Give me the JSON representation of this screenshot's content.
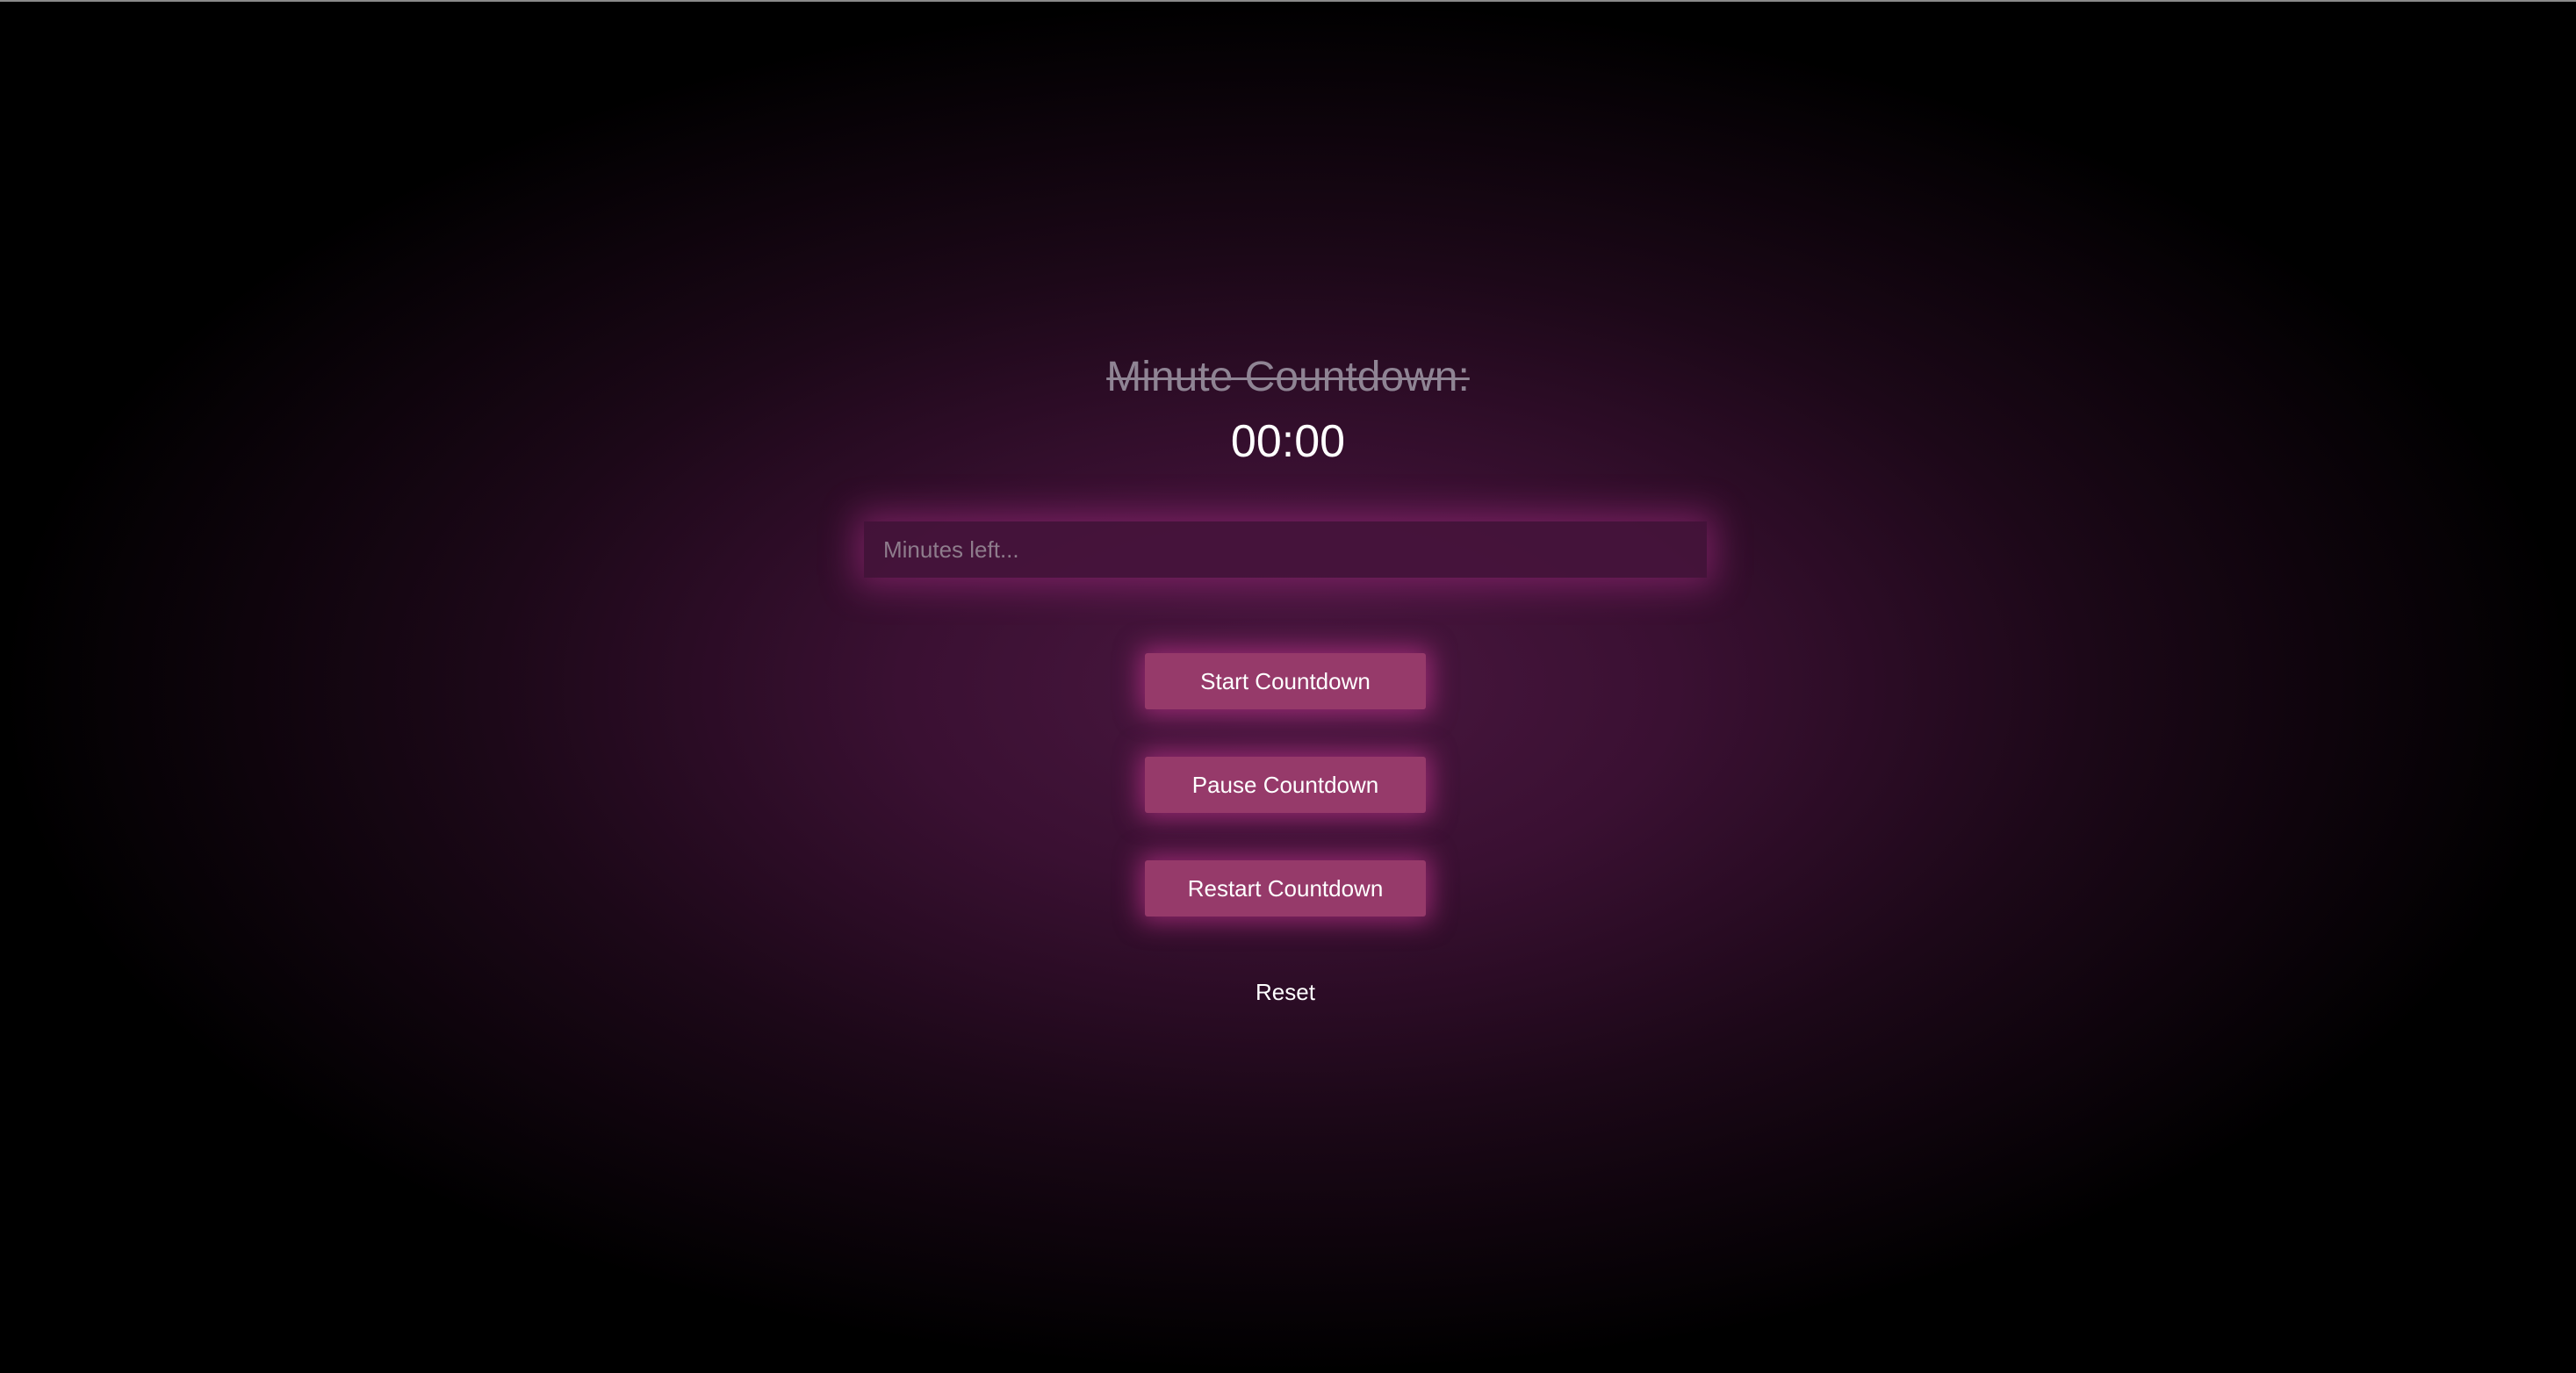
{
  "header": {
    "title": "Minute Countdown:",
    "timer_display": "00:00"
  },
  "input": {
    "placeholder": "Minutes left...",
    "value": ""
  },
  "buttons": {
    "start_label": "Start Countdown",
    "pause_label": "Pause Countdown",
    "restart_label": "Restart Countdown",
    "reset_label": "Reset"
  },
  "colors": {
    "accent": "#963a6a",
    "glow": "#dc3ca0",
    "background_center": "#4a1740",
    "background_edge": "#000000",
    "title_text": "#8f8494"
  }
}
